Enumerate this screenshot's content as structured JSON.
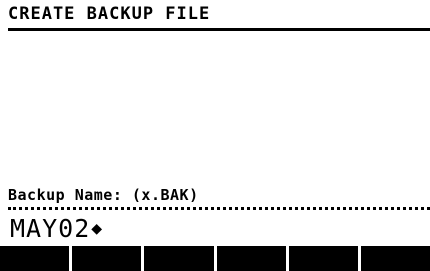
{
  "title": "CREATE BACKUP FILE",
  "prompt_label": "Backup Name: (x.BAK)",
  "input": {
    "value": "MAY02",
    "cursor": "◆"
  },
  "softkeys": [
    "",
    "",
    "",
    "",
    "",
    ""
  ]
}
